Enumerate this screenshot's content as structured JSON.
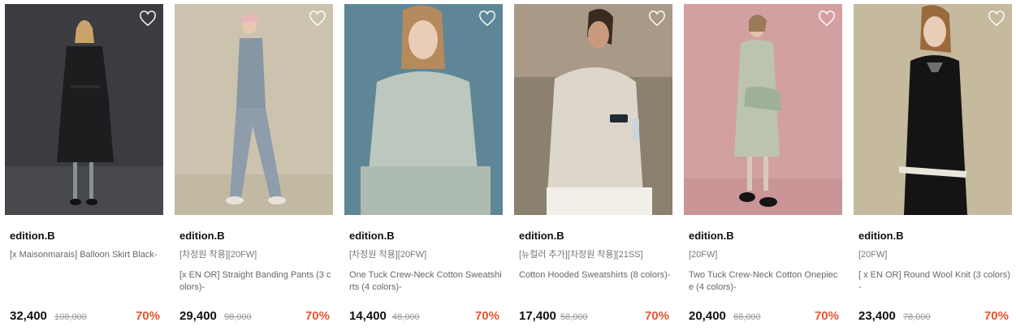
{
  "products": [
    {
      "brand": "edition.B",
      "tag": "",
      "name": "[x Maisonmarais] Balloon Skirt Black-",
      "price": "32,400",
      "original_price": "108,000",
      "discount": "70%",
      "bg_color": "#3b3d40"
    },
    {
      "brand": "edition.B",
      "tag": "[차정원 착용][20FW]",
      "name": "[x EN OR] Straight Banding Pants (3 colors)-",
      "price": "29,400",
      "original_price": "98,000",
      "discount": "70%",
      "bg_color": "#c9c1ad"
    },
    {
      "brand": "edition.B",
      "tag": "[차정원 착용][20FW]",
      "name": "One Tuck Crew-Neck Cotton Sweatshirts (4 colors)-",
      "price": "14,400",
      "original_price": "48,000",
      "discount": "70%",
      "bg_color": "#5f8798"
    },
    {
      "brand": "edition.B",
      "tag": "[뉴컬러 추가][차정원 착용][21SS]",
      "name": "Cotton Hooded Sweatshirts (8 colors)-",
      "price": "17,400",
      "original_price": "58,000",
      "discount": "70%",
      "bg_color": "#968977"
    },
    {
      "brand": "edition.B",
      "tag": "[20FW]",
      "name": "Two Tuck Crew-Neck Cotton Onepiece (4 colors)-",
      "price": "20,400",
      "original_price": "68,000",
      "discount": "70%",
      "bg_color": "#d49fa0"
    },
    {
      "brand": "edition.B",
      "tag": "[20FW]",
      "name": "[ x EN OR] Round Wool Knit (3 colors)-",
      "price": "23,400",
      "original_price": "78,000",
      "discount": "70%",
      "bg_color": "#c4b89d"
    }
  ],
  "colors": {
    "discount": "#e8542e",
    "price": "#111111",
    "original_price": "#999999"
  },
  "icons": {
    "wishlist": "heart-outline-icon"
  }
}
